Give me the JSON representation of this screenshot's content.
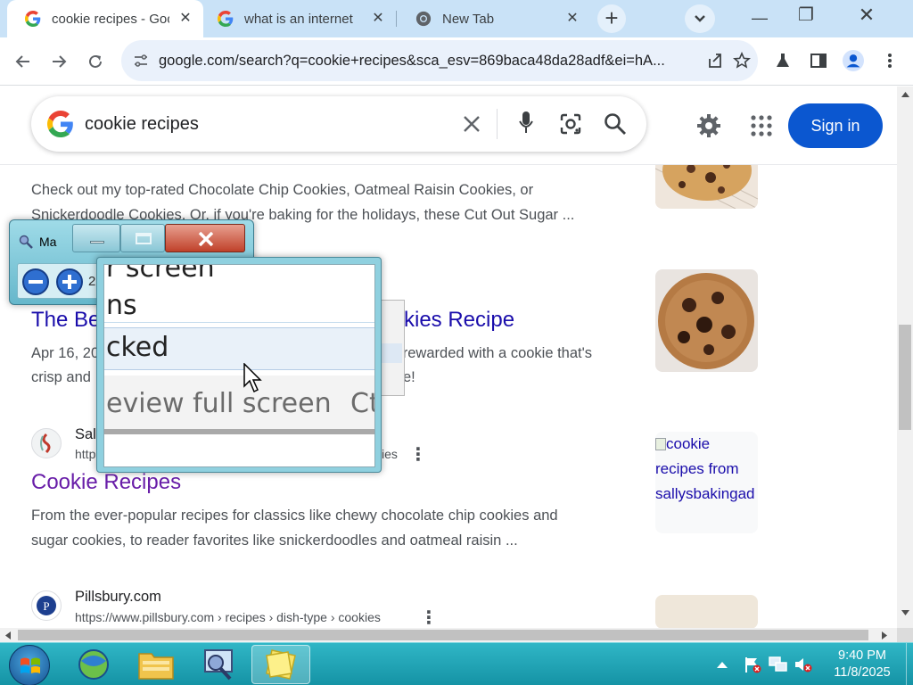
{
  "tabs": [
    {
      "title": "cookie recipes - Google Search",
      "active": true,
      "icon": "google-g-icon"
    },
    {
      "title": "what is an internet",
      "active": false,
      "icon": "google-g-icon"
    },
    {
      "title": "New Tab",
      "active": false,
      "icon": "chrome-icon"
    }
  ],
  "tab_close_glyph": "✕",
  "newtab_glyph": "+",
  "window_controls": {
    "minimize": "—",
    "restore": "❐",
    "close": "✕"
  },
  "address": {
    "url": "google.com/search?q=cookie+recipes&sca_esv=869baca48da28adf&ei=hA..."
  },
  "google": {
    "query": "cookie recipes",
    "signin_label": "Sign in"
  },
  "results": {
    "snippet1_line1": "Check out my top-rated Chocolate Chip Cookies, Oatmeal Raisin Cookies, or",
    "snippet1_line2": "Snickerdoodle Cookies. Or, if you're baking for the holidays, these Cut Out Sugar ...",
    "title2_left": "The Be",
    "title2_right": "kies Recipe",
    "date2": "Apr 16, 20",
    "snippet2_right1": "e rewarded with a cookie that's",
    "snippet2_left2": "crisp and",
    "snippet2_right2": "e!",
    "site3_name_partial": "Sal",
    "site3_url_partial": "http",
    "site3_url_tail": "ies",
    "title3": "Cookie Recipes",
    "snippet3_line1": "From the ever-popular recipes for classics like chewy chocolate chip cookies and",
    "snippet3_line2": "sugar cookies, to reader favorites like snickerdoodles and oatmeal raisin ...",
    "thumb3_alt": "cookie recipes from sallysbakingad",
    "site4_name": "Pillsbury.com",
    "site4_url": "https://www.pillsbury.com › recipes › dish-type › cookies"
  },
  "magnifier": {
    "title": "Ma",
    "zoom_partial": "2",
    "lens_lines": [
      "r screen",
      "ns",
      "cked",
      "eview full screen",
      "Ct"
    ]
  },
  "taskbar": {
    "time": "9:40 PM",
    "date": "11/8/2025"
  },
  "colors": {
    "chrome_tabstrip": "#c9e2f7",
    "google_blue": "#0b57d0",
    "link_blue": "#1a0dab",
    "visited_purple": "#681da8",
    "taskbar": "#1593a5"
  }
}
